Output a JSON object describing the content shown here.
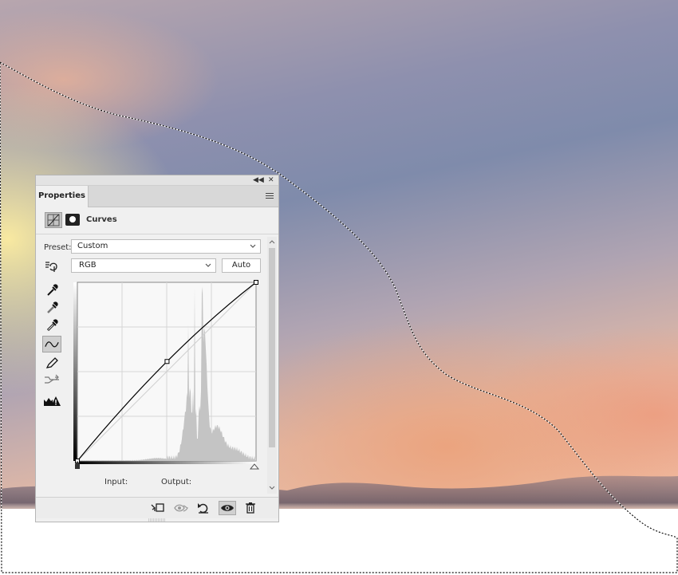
{
  "panel": {
    "tab_label": "Properties",
    "adjustment_title": "Curves",
    "preset_label": "Preset:",
    "preset_value": "Custom",
    "channel_value": "RGB",
    "auto_label": "Auto",
    "input_label": "Input:",
    "output_label": "Output:"
  },
  "icons": {
    "collapse": "double-chevron-left-icon",
    "close": "close-icon",
    "panel_menu": "panel-menu-icon",
    "curves_adjustment": "curves-adjustment-icon",
    "layer_mask": "layer-mask-icon",
    "on_image_adjust": "hand-adjust-icon",
    "eyedropper_black": "black-point-eyedropper-icon",
    "eyedropper_gray": "gray-point-eyedropper-icon",
    "eyedropper_white": "white-point-eyedropper-icon",
    "edit_points": "edit-points-curve-icon",
    "draw_curve": "pencil-icon",
    "smooth_curve": "smooth-curve-icon",
    "clipping_warning": "clipping-warning-icon",
    "clip_to_layer": "clip-to-layer-icon",
    "view_previous": "view-previous-state-icon",
    "reset": "reset-icon",
    "visibility": "eye-icon",
    "delete": "trash-icon"
  },
  "colors": {
    "panel_bg": "#f0f0f0",
    "histogram": "#c4c4c4",
    "curve": "#000000",
    "selection": "#000000"
  },
  "curve": {
    "points": [
      [
        0,
        0
      ],
      [
        128,
        142
      ],
      [
        255,
        255
      ]
    ],
    "range": [
      0,
      255
    ]
  }
}
